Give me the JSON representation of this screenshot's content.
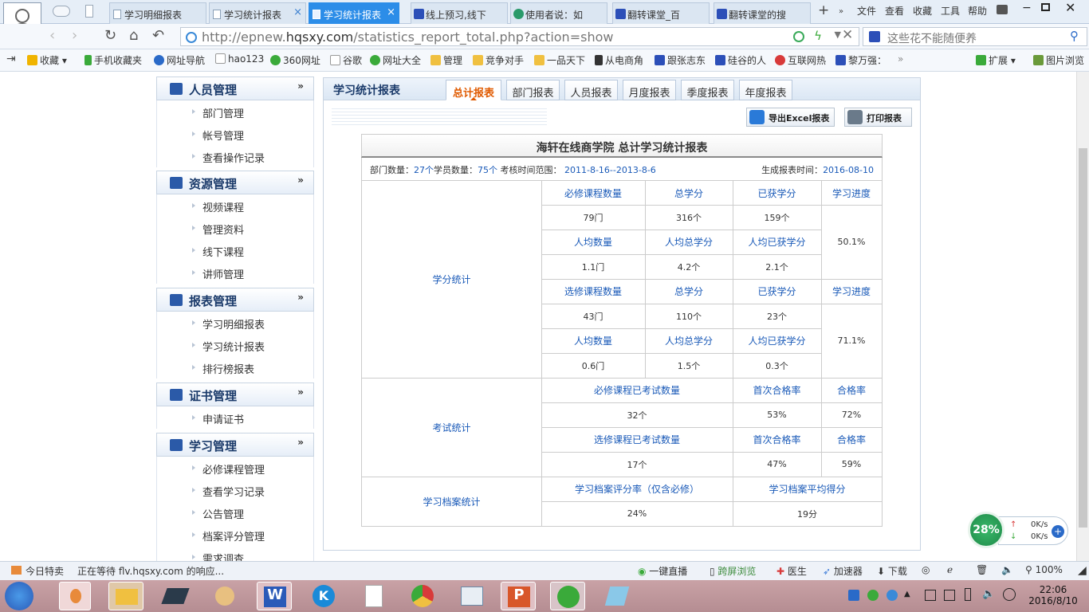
{
  "browser": {
    "tabs": [
      {
        "label": "学习明细报表",
        "active": false
      },
      {
        "label": "学习统计报表",
        "active": false
      },
      {
        "label": "学习统计报表",
        "active": true
      },
      {
        "label": "线上预习,线下",
        "active": false
      },
      {
        "label": "使用者说：如",
        "active": false
      },
      {
        "label": "翻转课堂_百",
        "active": false
      },
      {
        "label": "翻转课堂的搜",
        "active": false
      }
    ],
    "close_glyph": "×",
    "new_tab": "+",
    "menus": [
      "文件",
      "查看",
      "收藏",
      "工具",
      "帮助"
    ],
    "url_prefix": "http://epnew.",
    "url_domain": "hqsxy.com",
    "url_path": "/statistics_report_total.php?action=show",
    "search_placeholder": "这些花不能随便养",
    "bookmarks": [
      "收藏",
      "手机收藏夹",
      "网址导航",
      "hao123",
      "360网址",
      "谷歌",
      "网址大全",
      "管理",
      "竞争对手",
      "一品天下",
      "从电商角",
      "跟张志东",
      "硅谷的人",
      "互联网热",
      "黎万强：",
      "扩展",
      "图片浏览"
    ]
  },
  "sidebar": {
    "sections": [
      {
        "title": "人员管理",
        "items": [
          "部门管理",
          "帐号管理",
          "查看操作记录"
        ]
      },
      {
        "title": "资源管理",
        "items": [
          "视频课程",
          "管理资料",
          "线下课程",
          "讲师管理"
        ]
      },
      {
        "title": "报表管理",
        "items": [
          "学习明细报表",
          "学习统计报表",
          "排行榜报表"
        ]
      },
      {
        "title": "证书管理",
        "items": [
          "申请证书"
        ]
      },
      {
        "title": "学习管理",
        "items": [
          "必修课程管理",
          "查看学习记录",
          "公告管理",
          "档案评分管理",
          "需求调查"
        ]
      }
    ],
    "chevron": "»"
  },
  "main": {
    "title": "学习统计报表",
    "tabs": [
      "总计报表",
      "部门报表",
      "人员报表",
      "月度报表",
      "季度报表",
      "年度报表"
    ],
    "export_button": "导出Excel报表",
    "print_button": "打印报表"
  },
  "report": {
    "title": "海轩在线商学院 总计学习统计报表",
    "info_dept_label": "部门数量：",
    "info_dept_value": "27个",
    "info_user_label": "学员数量：",
    "info_user_value": "75个",
    "info_range_label": "考核时间范围：",
    "info_range_value": "2011-8-16--2013-8-6",
    "info_gen_label": "生成报表时间：",
    "info_gen_value": "2016-08-10",
    "credit": {
      "label": "学分统计",
      "required_headers": [
        "必修课程数量",
        "总学分",
        "已获学分",
        "学习进度"
      ],
      "required_values": [
        "79门",
        "316个",
        "159个"
      ],
      "required_avg_headers": [
        "人均数量",
        "人均总学分",
        "人均已获学分"
      ],
      "required_avg_values": [
        "1.1门",
        "4.2个",
        "2.1个"
      ],
      "required_progress": "50.1%",
      "elective_headers": [
        "选修课程数量",
        "总学分",
        "已获学分",
        "学习进度"
      ],
      "elective_values": [
        "43门",
        "110个",
        "23个"
      ],
      "elective_avg_headers": [
        "人均数量",
        "人均总学分",
        "人均已获学分"
      ],
      "elective_avg_values": [
        "0.6门",
        "1.5个",
        "0.3个"
      ],
      "elective_progress": "71.1%"
    },
    "exam": {
      "label": "考试统计",
      "required_headers": [
        "必修课程已考试数量",
        "首次合格率",
        "合格率"
      ],
      "required_values": [
        "32个",
        "53%",
        "72%"
      ],
      "elective_headers": [
        "选修课程已考试数量",
        "首次合格率",
        "合格率"
      ],
      "elective_values": [
        "17个",
        "47%",
        "59%"
      ]
    },
    "archive": {
      "label": "学习档案统计",
      "headers": [
        "学习档案评分率（仅含必修）",
        "学习档案平均得分"
      ],
      "values": [
        "24%",
        "19分"
      ]
    }
  },
  "status": {
    "left_label": "今日特卖",
    "loading": "正在等待 flv.hqsxy.com 的响应...",
    "items": [
      "一键直播",
      "跨屏浏览",
      "医生",
      "加速器",
      "下载"
    ],
    "zoom": "100%"
  },
  "speed_widget": {
    "percent": "28%",
    "up": "0K/s",
    "down": "0K/s"
  },
  "taskbar": {
    "time": "22:06",
    "date": "2016/8/10"
  },
  "colors": {
    "accent": "#2c8de8",
    "active_tab_text": "#e05a00",
    "link_blue": "#1a5ab8"
  }
}
